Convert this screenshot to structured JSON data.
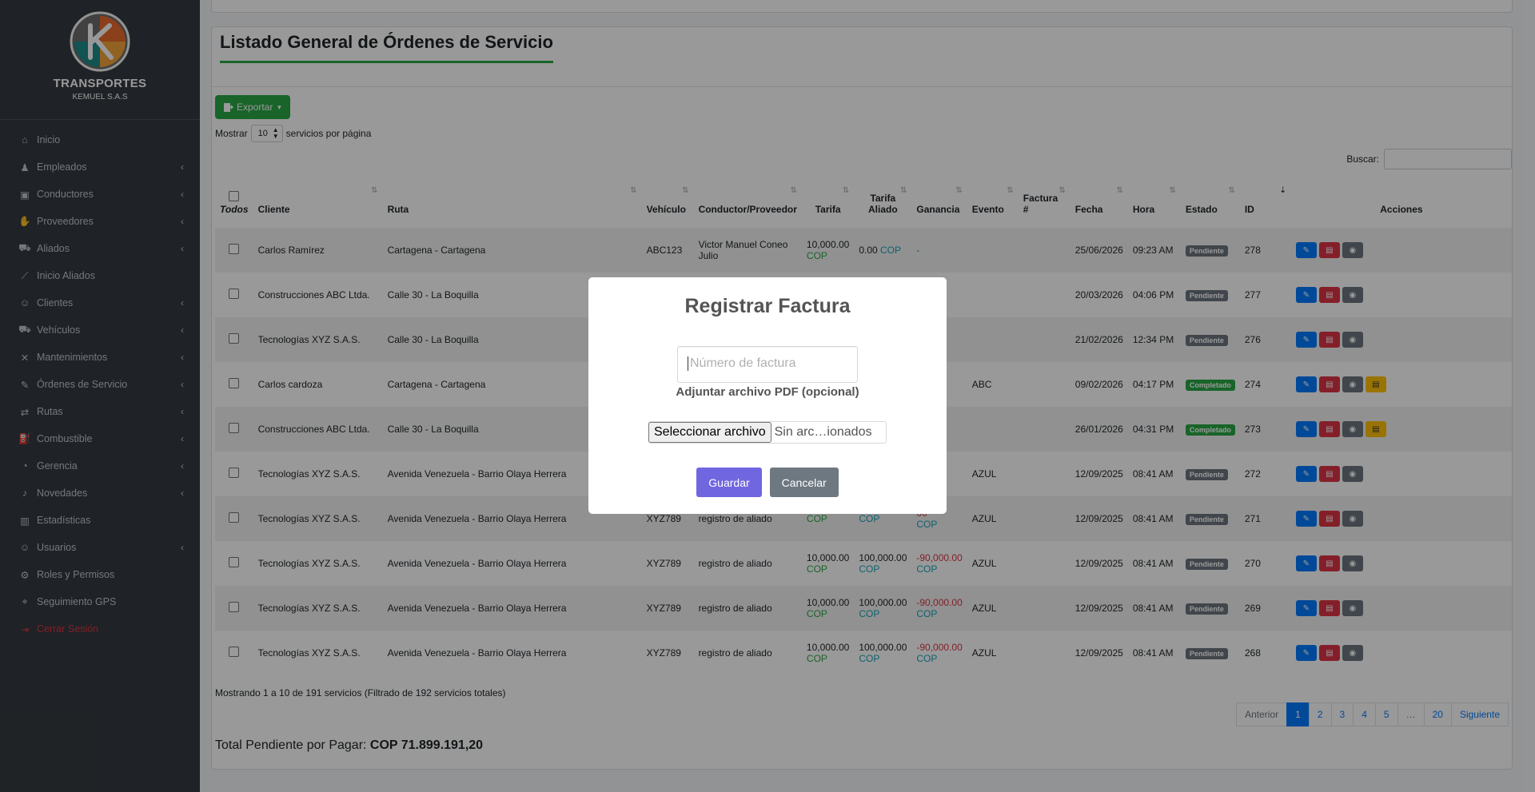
{
  "sidebar": {
    "brand_title": "TRANSPORTES",
    "brand_sub": "KEMUEL S.A.S",
    "items": [
      {
        "label": "Inicio",
        "icon": "home-icon",
        "chevron": false
      },
      {
        "label": "Empleados",
        "icon": "user-tie-icon",
        "chevron": true
      },
      {
        "label": "Conductores",
        "icon": "id-card-icon",
        "chevron": true
      },
      {
        "label": "Proveedores",
        "icon": "handshake-icon",
        "chevron": true
      },
      {
        "label": "Aliados",
        "icon": "car-side-icon",
        "chevron": true
      },
      {
        "label": "Inicio Aliados",
        "icon": "chart-line-icon",
        "chevron": false
      },
      {
        "label": "Clientes",
        "icon": "users-icon",
        "chevron": true
      },
      {
        "label": "Vehículos",
        "icon": "car-icon",
        "chevron": true
      },
      {
        "label": "Mantenimientos",
        "icon": "tools-icon",
        "chevron": true
      },
      {
        "label": "Órdenes de Servicio",
        "icon": "edit-icon",
        "chevron": true
      },
      {
        "label": "Rutas",
        "icon": "route-icon",
        "chevron": true
      },
      {
        "label": "Combustible",
        "icon": "gas-pump-icon",
        "chevron": true
      },
      {
        "label": "Gerencia",
        "icon": "pie-chart-icon",
        "chevron": true
      },
      {
        "label": "Novedades",
        "icon": "bell-icon",
        "chevron": true
      },
      {
        "label": "Estadísticas",
        "icon": "chart-bar-icon",
        "chevron": false
      },
      {
        "label": "Usuarios",
        "icon": "user-icon",
        "chevron": true
      },
      {
        "label": "Roles y Permisos",
        "icon": "user-cog-icon",
        "chevron": false
      },
      {
        "label": "Seguimiento GPS",
        "icon": "map-marker-icon",
        "chevron": false
      },
      {
        "label": "Cerrar Sesión",
        "icon": "sign-out-icon",
        "chevron": false
      }
    ]
  },
  "main": {
    "title": "Listado General de Órdenes de Servicio",
    "export_label": "Exportar",
    "show_prefix": "Mostrar",
    "show_value": "10",
    "show_suffix": "servicios por página",
    "search_label": "Buscar:",
    "select_all_label": "Todos",
    "columns": {
      "cliente": "Cliente",
      "ruta": "Ruta",
      "vehiculo": "Vehículo",
      "conductor": "Conductor/Proveedor",
      "tarifa": "Tarifa",
      "tarifa_aliado_1": "Tarifa",
      "tarifa_aliado_2": "Aliado",
      "ganancia": "Ganancia",
      "evento": "Evento",
      "factura_1": "Factura",
      "factura_2": "#",
      "fecha": "Fecha",
      "hora": "Hora",
      "estado": "Estado",
      "id": "ID",
      "acciones": "Acciones"
    },
    "rows": [
      {
        "cliente": "Carlos Ramírez",
        "ruta": "Cartagena - Cartagena",
        "vehiculo": "ABC123",
        "conductor": "Victor Manuel Coneo Julio",
        "tarifa": "10,000.00",
        "tarifa_cop": "COP",
        "aliado": "0.00",
        "aliado_cop": "COP",
        "ganancia": "-",
        "ganancia_cop": "",
        "evento": "",
        "fecha": "25/06/2026",
        "hora": "09:23 AM",
        "estado": "Pendiente",
        "id": "278",
        "extra": false
      },
      {
        "cliente": "Construcciones ABC Ltda.",
        "ruta": "Calle 30 - La Boquilla",
        "vehiculo": "",
        "conductor": "",
        "tarifa": "",
        "tarifa_cop": "",
        "aliado": "",
        "aliado_cop": "",
        "ganancia": "",
        "ganancia_cop": "",
        "evento": "",
        "fecha": "20/03/2026",
        "hora": "04:06 PM",
        "estado": "Pendiente",
        "id": "277",
        "extra": false
      },
      {
        "cliente": "Tecnologías XYZ S.A.S.",
        "ruta": "Calle 30 - La Boquilla",
        "vehiculo": "",
        "conductor": "",
        "tarifa": "",
        "tarifa_cop": "",
        "aliado": "",
        "aliado_cop": "",
        "ganancia": "",
        "ganancia_cop": "",
        "evento": "",
        "fecha": "21/02/2026",
        "hora": "12:34 PM",
        "estado": "Pendiente",
        "id": "276",
        "extra": false
      },
      {
        "cliente": "Carlos cardoza",
        "ruta": "Cartagena - Cartagena",
        "vehiculo": "",
        "conductor": "",
        "tarifa": "",
        "tarifa_cop": "",
        "aliado": "",
        "aliado_cop": "",
        "ganancia": "00",
        "ganancia_cop": "",
        "evento": "ABC",
        "fecha": "09/02/2026",
        "hora": "04:17 PM",
        "estado": "Completado",
        "id": "274",
        "extra": true
      },
      {
        "cliente": "Construcciones ABC Ltda.",
        "ruta": "Calle 30 - La Boquilla",
        "vehiculo": "",
        "conductor": "",
        "tarifa": "",
        "tarifa_cop": "",
        "aliado": "",
        "aliado_cop": "",
        "ganancia": "00",
        "ganancia_cop": "",
        "evento": "",
        "fecha": "26/01/2026",
        "hora": "04:31 PM",
        "estado": "Completado",
        "id": "273",
        "extra": true
      },
      {
        "cliente": "Tecnologías XYZ S.A.S.",
        "ruta": "Avenida Venezuela - Barrio Olaya Herrera",
        "vehiculo": "",
        "conductor": "",
        "tarifa": "",
        "tarifa_cop": "",
        "aliado": "",
        "aliado_cop": "",
        "ganancia": "00",
        "ganancia_cop": "",
        "evento": "AZUL",
        "fecha": "12/09/2025",
        "hora": "08:41 AM",
        "estado": "Pendiente",
        "id": "272",
        "extra": false
      },
      {
        "cliente": "Tecnologías XYZ S.A.S.",
        "ruta": "Avenida Venezuela - Barrio Olaya Herrera",
        "vehiculo": "XYZ789",
        "conductor": "registro de aliado",
        "tarifa": "",
        "tarifa_cop": "COP",
        "aliado": "",
        "aliado_cop": "COP",
        "ganancia": "00",
        "ganancia_cop": "COP",
        "evento": "AZUL",
        "fecha": "12/09/2025",
        "hora": "08:41 AM",
        "estado": "Pendiente",
        "id": "271",
        "extra": false
      },
      {
        "cliente": "Tecnologías XYZ S.A.S.",
        "ruta": "Avenida Venezuela - Barrio Olaya Herrera",
        "vehiculo": "XYZ789",
        "conductor": "registro de aliado",
        "tarifa": "10,000.00",
        "tarifa_cop": "COP",
        "aliado": "100,000.00",
        "aliado_cop": "COP",
        "ganancia": "-90,000.00",
        "ganancia_cop": "COP",
        "evento": "AZUL",
        "fecha": "12/09/2025",
        "hora": "08:41 AM",
        "estado": "Pendiente",
        "id": "270",
        "extra": false
      },
      {
        "cliente": "Tecnologías XYZ S.A.S.",
        "ruta": "Avenida Venezuela - Barrio Olaya Herrera",
        "vehiculo": "XYZ789",
        "conductor": "registro de aliado",
        "tarifa": "10,000.00",
        "tarifa_cop": "COP",
        "aliado": "100,000.00",
        "aliado_cop": "COP",
        "ganancia": "-90,000.00",
        "ganancia_cop": "COP",
        "evento": "AZUL",
        "fecha": "12/09/2025",
        "hora": "08:41 AM",
        "estado": "Pendiente",
        "id": "269",
        "extra": false
      },
      {
        "cliente": "Tecnologías XYZ S.A.S.",
        "ruta": "Avenida Venezuela - Barrio Olaya Herrera",
        "vehiculo": "XYZ789",
        "conductor": "registro de aliado",
        "tarifa": "10,000.00",
        "tarifa_cop": "COP",
        "aliado": "100,000.00",
        "aliado_cop": "COP",
        "ganancia": "-90,000.00",
        "ganancia_cop": "COP",
        "evento": "AZUL",
        "fecha": "12/09/2025",
        "hora": "08:41 AM",
        "estado": "Pendiente",
        "id": "268",
        "extra": false
      }
    ],
    "info_text": "Mostrando 1 a 10 de 191 servicios (Filtrado de 192 servicios totales)",
    "pagination": [
      "Anterior",
      "1",
      "2",
      "3",
      "4",
      "5",
      "…",
      "20",
      "Siguiente"
    ],
    "active_page": "1",
    "total_label": "Total Pendiente por Pagar:",
    "total_value": "COP 71.899.191,20"
  },
  "modal": {
    "title": "Registrar Factura",
    "input_placeholder": "Número de factura",
    "file_label": "Adjuntar archivo PDF (opcional)",
    "file_button": "Seleccionar archivo",
    "file_status": "Sin arc…ionados",
    "save_label": "Guardar",
    "cancel_label": "Cancelar"
  },
  "colors": {
    "primary": "#007bff",
    "success": "#28a745",
    "danger": "#dc3545",
    "sidebar": "#343a40",
    "modal_confirm": "#7066e0"
  }
}
